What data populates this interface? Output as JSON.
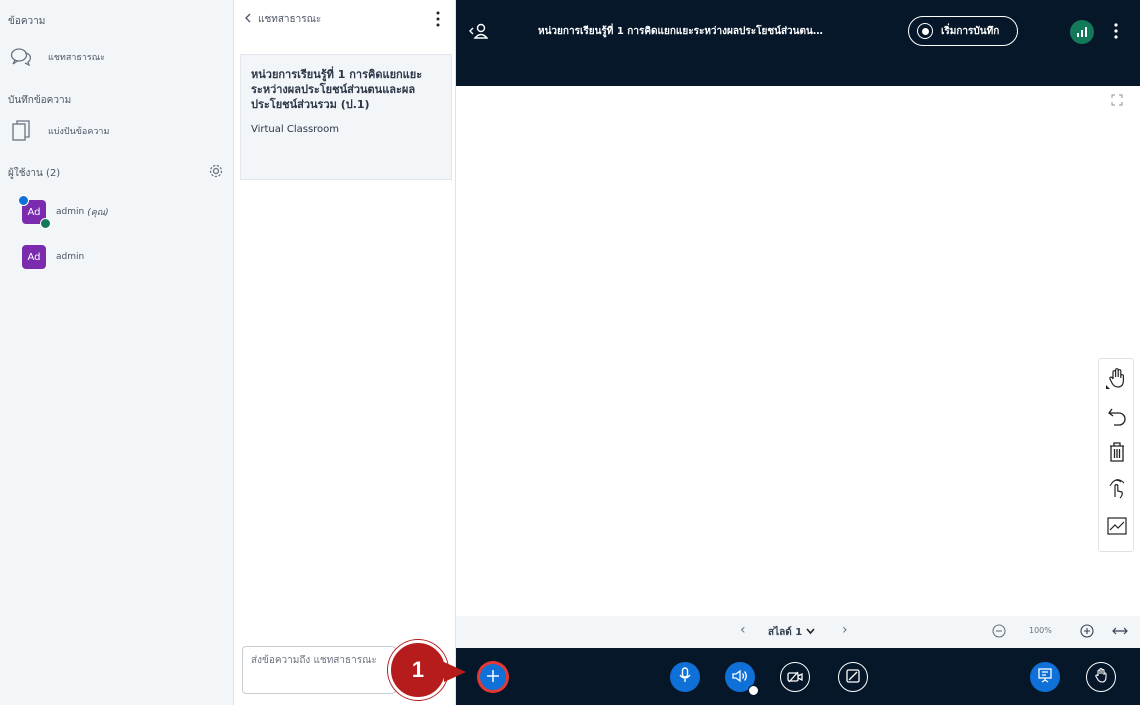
{
  "sidebar": {
    "messages_title": "ข้อความ",
    "public_chat_label": "แชทสาธารณะ",
    "notes_title": "บันทึกข้อความ",
    "shared_notes_label": "แบ่งปันข้อความ",
    "users_title": "ผู้ใช้งาน (2)",
    "users": [
      {
        "initials": "Ad",
        "name": "admin",
        "suffix": "(คุณ)"
      },
      {
        "initials": "Ad",
        "name": "admin",
        "suffix": ""
      }
    ]
  },
  "chat": {
    "header": "แชทสาธารณะ",
    "welcome_title": "หน่วยการเรียนรู้ที่ 1 การคิดแยกแยะระหว่างผลประโยชน์ส่วนตนและผลประโยชน์ส่วนรวม (ป.1)",
    "welcome_sub": "Virtual Classroom",
    "input_placeholder": "ส่งข้อความถึง แชทสาธารณะ"
  },
  "topbar": {
    "title": "หน่วยการเรียนรู้ที่ 1 การคิดแยกแยะระหว่างผลประโยชน์ส่วนตน…",
    "record_label": "เริ่มการบันทึก"
  },
  "slide_nav": {
    "slide_label": "สไลด์ 1",
    "zoom": "100%"
  },
  "annotation": {
    "step": "1"
  },
  "colors": {
    "bar": "#06172a",
    "accent": "#0f70d7",
    "avatar": "#7b2cae",
    "connection": "#13795b",
    "marker": "#b71c1c"
  }
}
